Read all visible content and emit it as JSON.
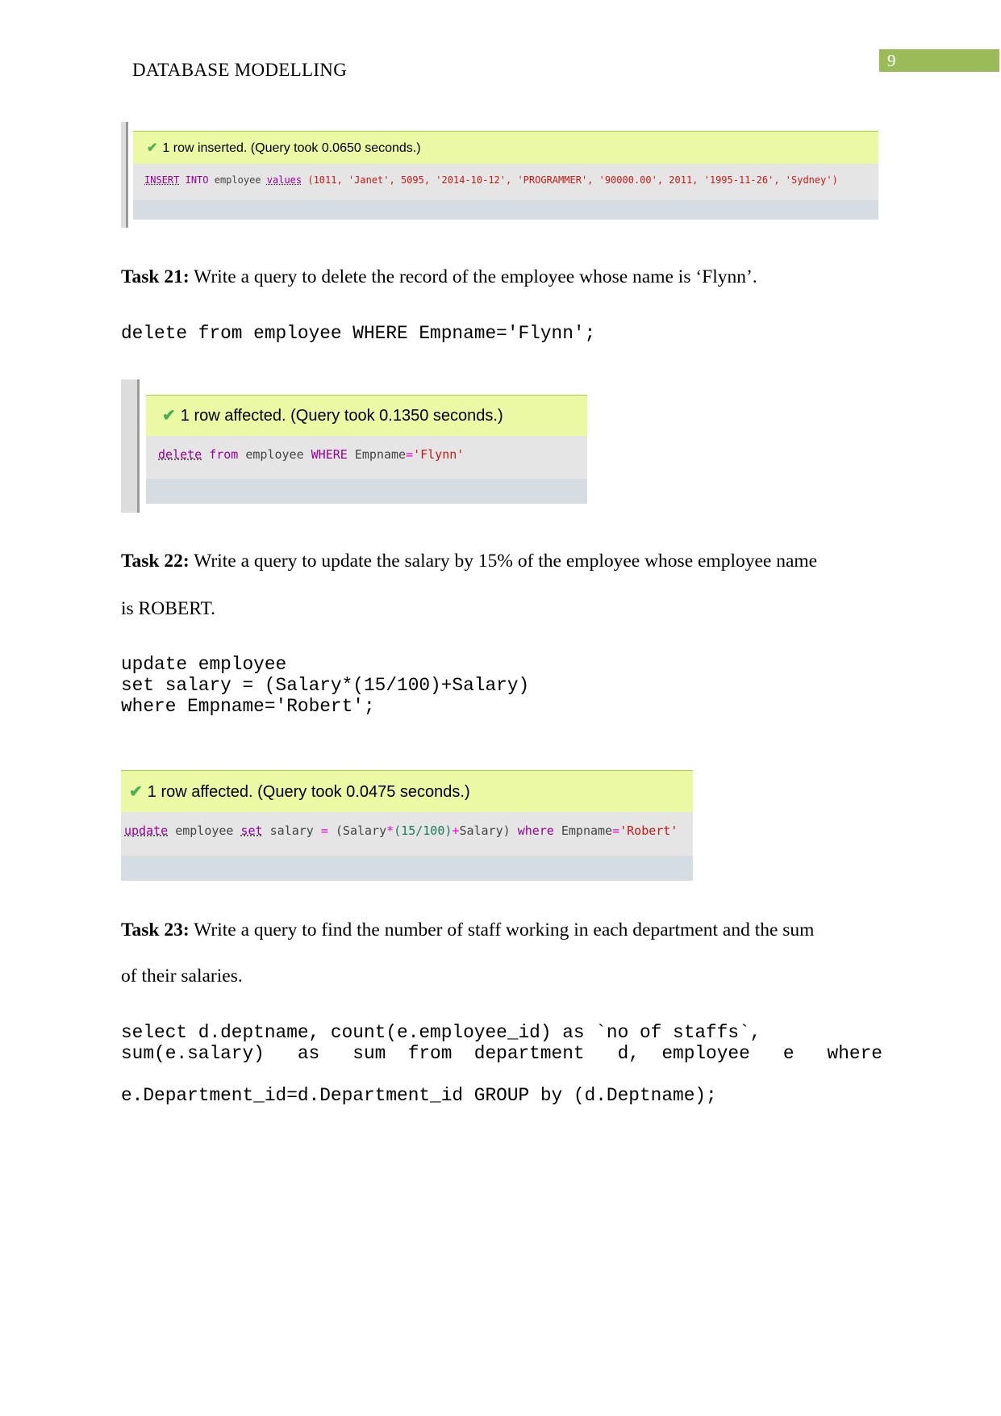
{
  "header": {
    "title": "DATABASE MODELLING",
    "page_number": "9",
    "page_number_color": "#9bbb59"
  },
  "panels": [
    {
      "message": "1 row inserted. (Query took 0.0650 seconds.)",
      "sql": {
        "k1": "INSERT",
        "k2": "INTO",
        "t1": "employee",
        "k3": "values",
        "rest": "(1011, 'Janet', 5095, '2014-10-12', 'PROGRAMMER', '90000.00', 2011, '1995-11-26', 'Sydney')"
      }
    },
    {
      "message": "1 row affected. (Query took 0.1350 seconds.)",
      "sql": {
        "k1": "delete",
        "k2": "from",
        "t1": "employee",
        "k3": "WHERE",
        "t2": "Empname",
        "op": "=",
        "str": "'Flynn'"
      }
    },
    {
      "message": "1 row affected. (Query took 0.0475 seconds.)",
      "sql": {
        "k1": "update",
        "t1": "employee",
        "k2": "set",
        "t2": "salary",
        "op": "=",
        "p1": "(Salary",
        "op2": "*",
        "p2": "(15/100)",
        "op3": "+",
        "p3": "Salary)",
        "k3": "where",
        "t3": "Empname",
        "op4": "=",
        "str": "'Robert'"
      }
    }
  ],
  "tasks": [
    {
      "label": "Task 21:",
      "text": " Write a query to delete the record of the employee whose name is ‘Flynn’.",
      "code": "delete from employee WHERE Empname='Flynn';"
    },
    {
      "label": "Task 22:",
      "text": " Write a query to update the salary by 15% of the employee whose employee name",
      "text2": "is ROBERT.",
      "code": "update employee\nset salary = (Salary*(15/100)+Salary)\nwhere Empname='Robert';"
    },
    {
      "label": "Task 23:",
      "text": " Write a query to find the number of staff working in each department and the sum",
      "text2": "of their salaries.",
      "code1": "select d.deptname, count(e.employee_id) as `no of staffs`,",
      "code2": "sum(e.salary)   as   sum  from  department   d,  employee   e   where",
      "code3": "e.Department_id=d.Department_id GROUP by (d.Deptname);"
    }
  ]
}
